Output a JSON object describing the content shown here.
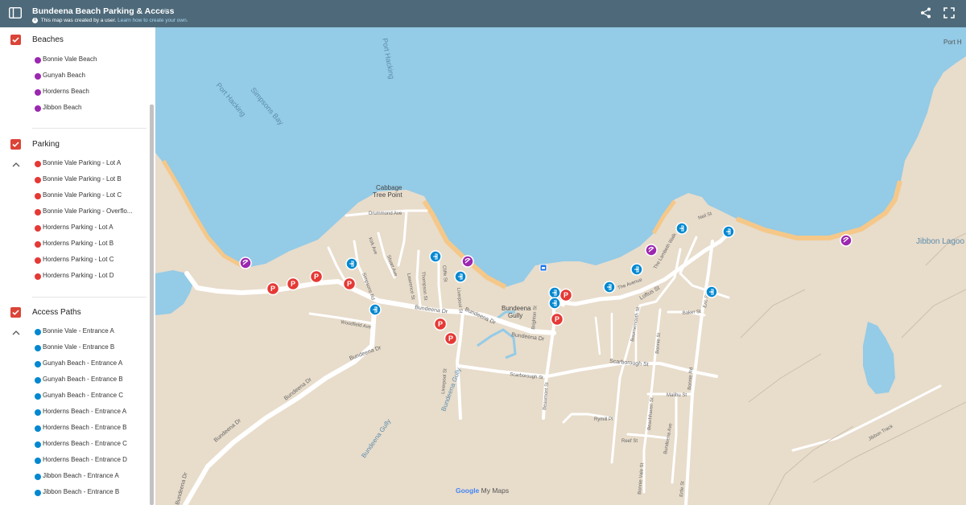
{
  "header": {
    "title": "Bundeena Beach Parking & Access",
    "subtitle_prefix": "This map was created by a user.",
    "subtitle_link": "Learn how to create your own.",
    "info_glyph": "i",
    "star_glyph": "★",
    "icons": [
      "sidebar-toggle-icon",
      "share-icon",
      "fullscreen-icon"
    ]
  },
  "layers": [
    {
      "name": "Beaches",
      "icon": "beach-umbrella-icon",
      "color": "#9c27b0",
      "items": [
        "Bonnie Vale Beach",
        "Gunyah Beach",
        "Horderns Beach",
        "Jibbon Beach"
      ]
    },
    {
      "name": "Parking",
      "icon": "parking-icon",
      "color": "#e53935",
      "items": [
        "Bonnie Vale Parking - Lot A",
        "Bonnie Vale Parking - Lot B",
        "Bonnie Vale Parking - Lot C",
        "Bonnie Vale Parking - Overflo...",
        "Horderns Parking - Lot A",
        "Horderns Parking - Lot B",
        "Horderns Parking - Lot C",
        "Horderns Parking - Lot D"
      ]
    },
    {
      "name": "Access Paths",
      "icon": "entrance-icon",
      "color": "#0288d1",
      "items": [
        "Bonnie Vale - Entrance A",
        "Bonnie Vale - Entrance B",
        "Gunyah Beach - Entrance A",
        "Gunyah Beach - Entrance B",
        "Gunyah Beach - Entrance C",
        "Horderns Beach - Entrance A",
        "Horderns Beach - Entrance B",
        "Horderns Beach - Entrance C",
        "Horderns Beach - Entrance D",
        "Jibbon Beach - Entrance A",
        "Jibbon Beach - Entrance B"
      ]
    }
  ],
  "map": {
    "colors": {
      "water": "#94cbe6",
      "land": "#e8dccb",
      "sand": "#f5c889",
      "road": "#ffffff"
    },
    "water_labels": {
      "port_hacking_1": "Port Hacking",
      "port_hacking_2": "Port Hacking",
      "simpsons_bay": "Simpsons Bay",
      "port_hacking_3": "Port H",
      "jibbon_lagoon": "Jibbon Lagoo",
      "bundeena_gully_1": "Bundeena Gully",
      "bundeena_gully_2": "Bundeena Gully"
    },
    "place_labels": {
      "cabbage_tree_point_1": "Cabbage",
      "cabbage_tree_point_2": "Tree Point",
      "bundeena_gully_1": "Bundeena",
      "bundeena_gully_2": "Gully"
    },
    "street_labels": {
      "drummond": "Drummond Ave",
      "kirk": "Kirk Ave",
      "stuart": "Stuart Ave",
      "simpsons_rd": "Simpsons Rd",
      "thompson": "Thompson St",
      "lawrence": "Lawrence St",
      "cliffe": "Cliffe St",
      "liverpool_1": "Liverpool St",
      "liverpool_2": "Liverpool St",
      "bundeena_dr_1": "Bundeena Dr",
      "bundeena_dr_2": "Bundeena Dr",
      "bundeena_dr_3": "Bundeena Dr",
      "bundeena_dr_4": "Bundeena Dr",
      "bundeena_dr_5": "Bundeena Dr",
      "bundeena_dr_6": "Bundeena Dr",
      "bundeena_dr_7": "Bundeena Dr",
      "woodfield": "Woodfield Ave",
      "brighton": "Brighton St",
      "scarborough_1": "Scarborough St",
      "scarborough_2": "Scarborough St",
      "loftus": "Loftus St",
      "the_avenue": "The Avenue",
      "the_lambeth": "The Lambeth Walk",
      "neil": "Neil St",
      "eric": "Eric St",
      "baker": "Baker St",
      "bournemouth": "Bournemouth St",
      "bonnie_vale_br": "Beachhaven St",
      "bundeena_ave": "Bundeena Ave",
      "malibu": "Malibu St",
      "reef": "Reef St",
      "rymill": "Rymill Pl",
      "bonnie": "Bonnie Vale St",
      "bonnie_2": "Bonnie St",
      "jibbon": "Jibbon Track",
      "ertle": "Ertle St",
      "bonnie_rd": "Bonnie Rd",
      "bonnie_st": "Beaumont St"
    },
    "pin_glyph_parking": "P",
    "attribution_brand": "Google",
    "attribution_rest": "My Maps"
  }
}
